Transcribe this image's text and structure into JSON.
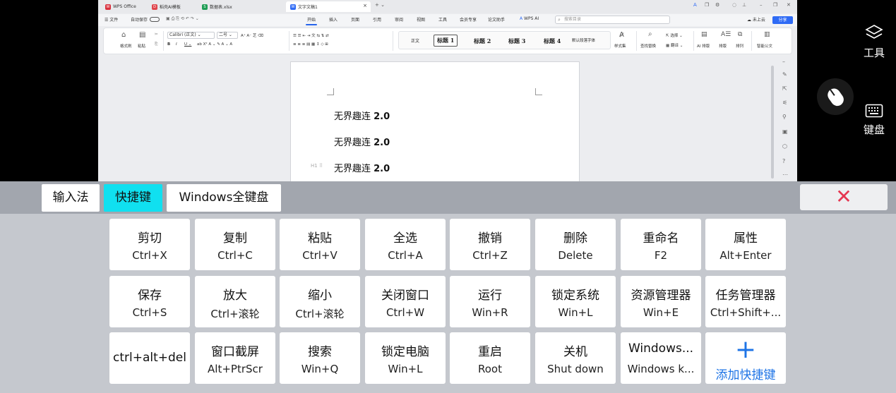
{
  "app": {
    "tabs": [
      {
        "label": "WPS Office",
        "icon": "wps-logo-icon",
        "color": "#d9303d"
      },
      {
        "label": "稻壳AI模板",
        "icon": "docer-icon",
        "color": "#e0454c"
      },
      {
        "label": "数据表.xlsx",
        "icon": "spreadsheet-icon",
        "color": "#1f9d55"
      },
      {
        "label": "文字文稿1",
        "icon": "writer-icon",
        "color": "#2f6bf5"
      }
    ],
    "menu": {
      "file": "文件",
      "autosave": "自动保存",
      "items": [
        "开始",
        "插入",
        "页面",
        "引用",
        "审阅",
        "视图",
        "工具",
        "会员专享",
        "论文助手",
        "WPS AI"
      ],
      "active": "开始",
      "search_placeholder": "搜索目录",
      "cloud": "未上云",
      "share": "分享"
    },
    "ribbon": {
      "format_brush": "格式刷",
      "paste": "粘贴",
      "font_name": "Calibri (正文)",
      "font_size": "二号",
      "styles": [
        "正文",
        "标题 1",
        "标题 2",
        "标题 3",
        "标题 4",
        "默认段落字体"
      ],
      "selected_style": "标题 1",
      "style_set": "样式集",
      "find_replace": "查找替换",
      "select": "选择",
      "translate": "翻译",
      "ai_layout": "AI 排版",
      "layout": "排版",
      "arrange": "排列",
      "smart_doc": "智能公文"
    },
    "document": {
      "lines": [
        {
          "text": "无界趣连 ",
          "version": "2.0"
        },
        {
          "text": "无界趣连 ",
          "version": "2.0"
        },
        {
          "text": "无界趣连 ",
          "version": "2.0"
        }
      ],
      "heading_marker": "H1"
    }
  },
  "side": {
    "tools_label": "工具",
    "keyboard_label": "键盘"
  },
  "panel": {
    "modes": [
      "输入法",
      "快捷键",
      "Windows全键盘"
    ],
    "active_mode": "快捷键",
    "close_symbol": "✕",
    "keys": [
      {
        "name": "剪切",
        "code": "Ctrl+X"
      },
      {
        "name": "复制",
        "code": "Ctrl+C"
      },
      {
        "name": "粘贴",
        "code": "Ctrl+V"
      },
      {
        "name": "全选",
        "code": "Ctrl+A"
      },
      {
        "name": "撤销",
        "code": "Ctrl+Z"
      },
      {
        "name": "删除",
        "code": "Delete"
      },
      {
        "name": "重命名",
        "code": "F2"
      },
      {
        "name": "属性",
        "code": "Alt+Enter"
      },
      {
        "name": "保存",
        "code": "Ctrl+S"
      },
      {
        "name": "放大",
        "code": "Ctrl+滚轮"
      },
      {
        "name": "缩小",
        "code": "Ctrl+滚轮"
      },
      {
        "name": "关闭窗口",
        "code": "Ctrl+W"
      },
      {
        "name": "运行",
        "code": "Win+R"
      },
      {
        "name": "锁定系统",
        "code": "Win+L"
      },
      {
        "name": "资源管理器",
        "code": "Win+E"
      },
      {
        "name": "任务管理器",
        "code": "Ctrl+Shift+..."
      },
      {
        "name": "ctrl+alt+del",
        "code": ""
      },
      {
        "name": "窗口截屏",
        "code": "Alt+PtrScr"
      },
      {
        "name": "搜索",
        "code": "Win+Q"
      },
      {
        "name": "锁定电脑",
        "code": "Win+L"
      },
      {
        "name": "重启",
        "code": "Root"
      },
      {
        "name": "关机",
        "code": "Shut down"
      },
      {
        "name": "Windows...",
        "code": "Windows k..."
      }
    ],
    "add_key": {
      "symbol": "+",
      "label": "添加快捷键"
    },
    "colors": {
      "active_mode": "#10e0f0",
      "close": "#e53650",
      "add": "#1e74e6"
    }
  }
}
